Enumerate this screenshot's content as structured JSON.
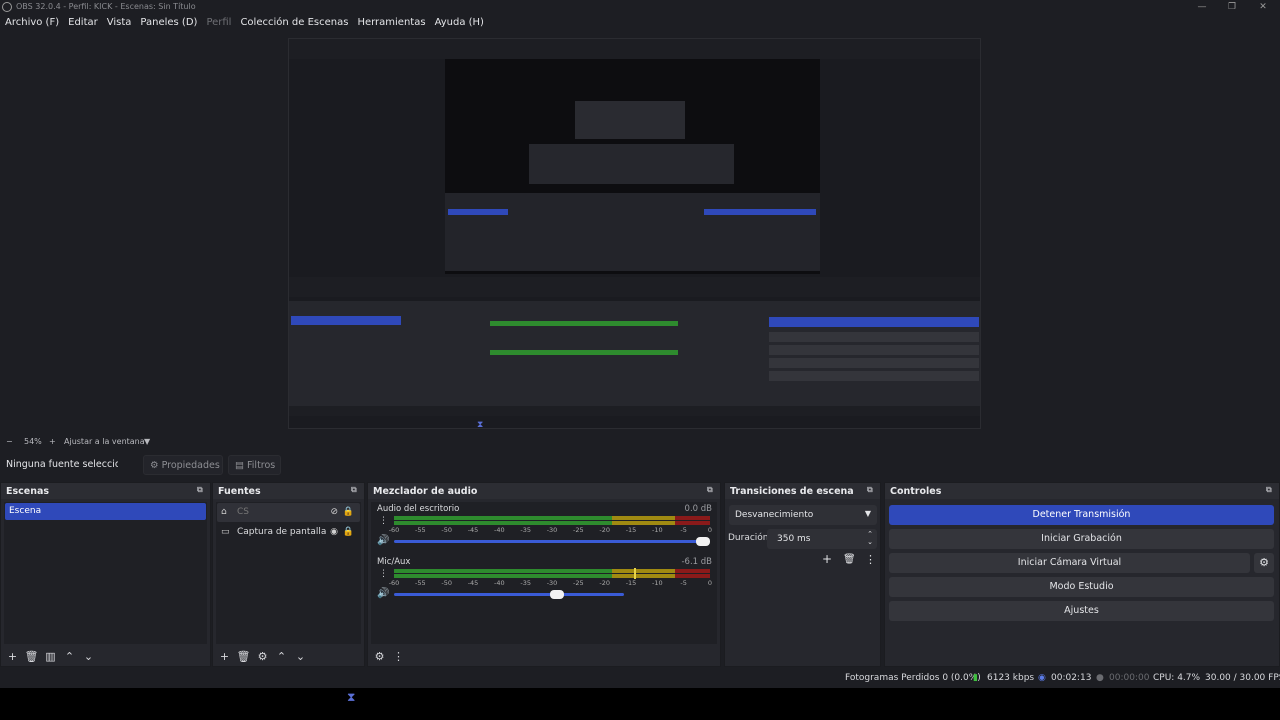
{
  "window": {
    "title": "OBS 32.0.4 - Perfil: KICK - Escenas: Sin Título",
    "minimize": "—",
    "maximize": "❐",
    "close": "✕"
  },
  "menu": [
    {
      "label": "Archivo (F)",
      "enabled": true
    },
    {
      "label": "Editar",
      "enabled": true
    },
    {
      "label": "Vista",
      "enabled": true
    },
    {
      "label": "Paneles (D)",
      "enabled": true
    },
    {
      "label": "Perfil",
      "enabled": false
    },
    {
      "label": "Colección de Escenas",
      "enabled": true
    },
    {
      "label": "Herramientas",
      "enabled": true
    },
    {
      "label": "Ayuda (H)",
      "enabled": true
    }
  ],
  "zoom": {
    "minus": "−",
    "value": "54%",
    "plus": "+",
    "fit_label": "Ajustar a la ventana",
    "arrow": "▼"
  },
  "context": {
    "no_source": "Ninguna fuente seleccionada",
    "properties": "Propiedades",
    "filters": "Filtros"
  },
  "scenes": {
    "title": "Escenas",
    "items": [
      "Escena"
    ]
  },
  "sources": {
    "title": "Fuentes",
    "items": [
      {
        "name": "CS",
        "icon": "gamepad-icon"
      },
      {
        "name": "Captura de pantalla",
        "icon": "monitor-icon"
      }
    ]
  },
  "mixer": {
    "title": "Mezclador de audio",
    "ticks": [
      "-60",
      "-55",
      "-50",
      "-45",
      "-40",
      "-35",
      "-30",
      "-25",
      "-20",
      "-15",
      "-10",
      "-5",
      "0"
    ],
    "channels": [
      {
        "name": "Audio del escritorio",
        "db": "0.0 dB",
        "volume": 1.0
      },
      {
        "name": "Mic/Aux",
        "db": "-6.1 dB",
        "volume": 0.74
      }
    ]
  },
  "transitions": {
    "title": "Transiciones de escena",
    "selected": "Desvanecimiento",
    "duration_label": "Duración",
    "duration_value": "350 ms"
  },
  "controls": {
    "title": "Controles",
    "stop_stream": "Detener Transmisión",
    "start_record": "Iniciar Grabación",
    "start_vcam": "Iniciar Cámara Virtual",
    "studio_mode": "Modo Estudio",
    "settings": "Ajustes"
  },
  "status": {
    "dropped": "Fotogramas Perdidos 0 (0.0%)",
    "bitrate": "6123 kbps",
    "stream_time": "00:02:13",
    "record_time": "00:00:00",
    "cpu": "CPU: 4.7%",
    "fps": "30.00 / 30.00 FPS"
  },
  "colors": {
    "accent": "#2f49ba",
    "meter_green": "#2e8b2e",
    "meter_yellow": "#a08a12",
    "meter_red": "#8a1a1a"
  }
}
